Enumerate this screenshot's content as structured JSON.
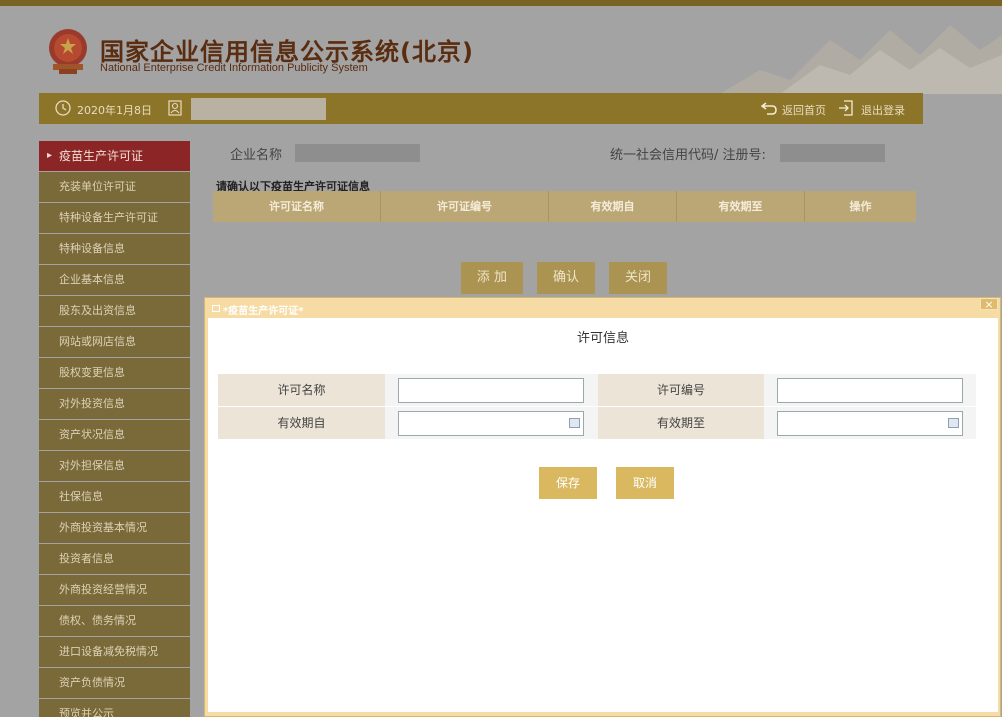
{
  "header": {
    "title": "国家企业信用信息公示系统(北京)",
    "subtitle": "National Enterprise Credit Information Publicity System"
  },
  "topbar": {
    "date": "2020年1月8日",
    "home_label": "返回首页",
    "logout_label": "退出登录"
  },
  "sidebar": {
    "items": [
      {
        "label": "疫苗生产许可证",
        "active": true
      },
      {
        "label": "充装单位许可证"
      },
      {
        "label": "特种设备生产许可证"
      },
      {
        "label": "特种设备信息"
      },
      {
        "label": "企业基本信息"
      },
      {
        "label": "股东及出资信息"
      },
      {
        "label": "网站或网店信息"
      },
      {
        "label": "股权变更信息"
      },
      {
        "label": "对外投资信息"
      },
      {
        "label": "资产状况信息"
      },
      {
        "label": "对外担保信息"
      },
      {
        "label": "社保信息"
      },
      {
        "label": "外商投资基本情况"
      },
      {
        "label": "投资者信息"
      },
      {
        "label": "外商投资经营情况"
      },
      {
        "label": "债权、债务情况"
      },
      {
        "label": "进口设备减免税情况"
      },
      {
        "label": "资产负债情况"
      },
      {
        "label": "预览并公示"
      }
    ]
  },
  "main": {
    "company_label": "企业名称",
    "credit_label": "统一社会信用代码/ 注册号:",
    "confirm_text": "请确认以下疫苗生产许可证信息",
    "table_headers": [
      "许可证名称",
      "许可证编号",
      "有效期自",
      "有效期至",
      "操作"
    ],
    "add_button": "添 加",
    "confirm_button": "确认",
    "close_button": "关闭"
  },
  "modal": {
    "title": "*疫苗生产许可证*",
    "close_glyph": "×",
    "form_title": "许可信息",
    "fields": {
      "license_name_label": "许可名称",
      "license_no_label": "许可编号",
      "valid_from_label": "有效期自",
      "valid_to_label": "有效期至",
      "license_name_value": "",
      "license_no_value": "",
      "valid_from_value": "",
      "valid_to_value": ""
    },
    "save_button": "保存",
    "cancel_button": "取消"
  },
  "colors": {
    "brand_gold": "#8c7429",
    "active_red": "#8c2626",
    "button_gold": "#d9b860"
  }
}
